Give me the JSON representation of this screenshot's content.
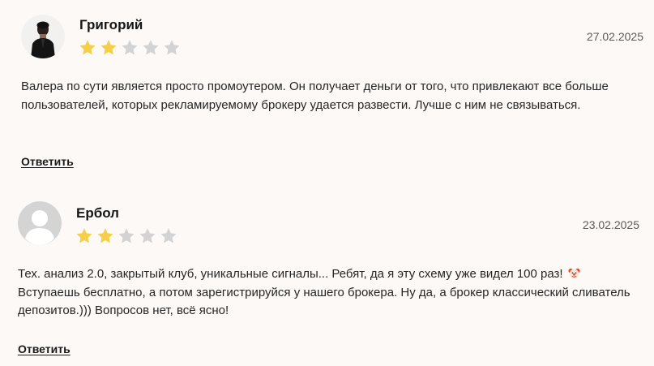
{
  "reviews": [
    {
      "author": "Григорий",
      "date": "27.02.2025",
      "rating": 2,
      "max_rating": 5,
      "avatar": "person-photo",
      "text": "Валера по сути является просто промоутером. Он получает деньги от того, что привлекают все больше пользователей, которых рекламируемому брокеру удается развести. Лучше с ним не связываться.",
      "reply_label": "Ответить"
    },
    {
      "author": "Ербол",
      "date": "23.02.2025",
      "rating": 2,
      "max_rating": 5,
      "avatar": "default-user-avatar",
      "text_before_emoji": "Тех. анализ 2.0, закрытый клуб, уникальные сигналы... Ребят, да я эту схему уже видел 100 раз!",
      "emoji": "clown-face-emoji",
      "text_after_emoji": "Вступаешь бесплатно, а потом зарегистрируйся у нашего брокера. Ну да, а брокер классический сливатель депозитов.))) Вопросов нет, всё ясно!",
      "reply_label": "Ответить"
    }
  ],
  "colors": {
    "background": "#fdf9f6",
    "star_filled": "#f5cf4a",
    "star_empty": "#d3d3d3",
    "avatar_placeholder": "#d4d4d4"
  }
}
